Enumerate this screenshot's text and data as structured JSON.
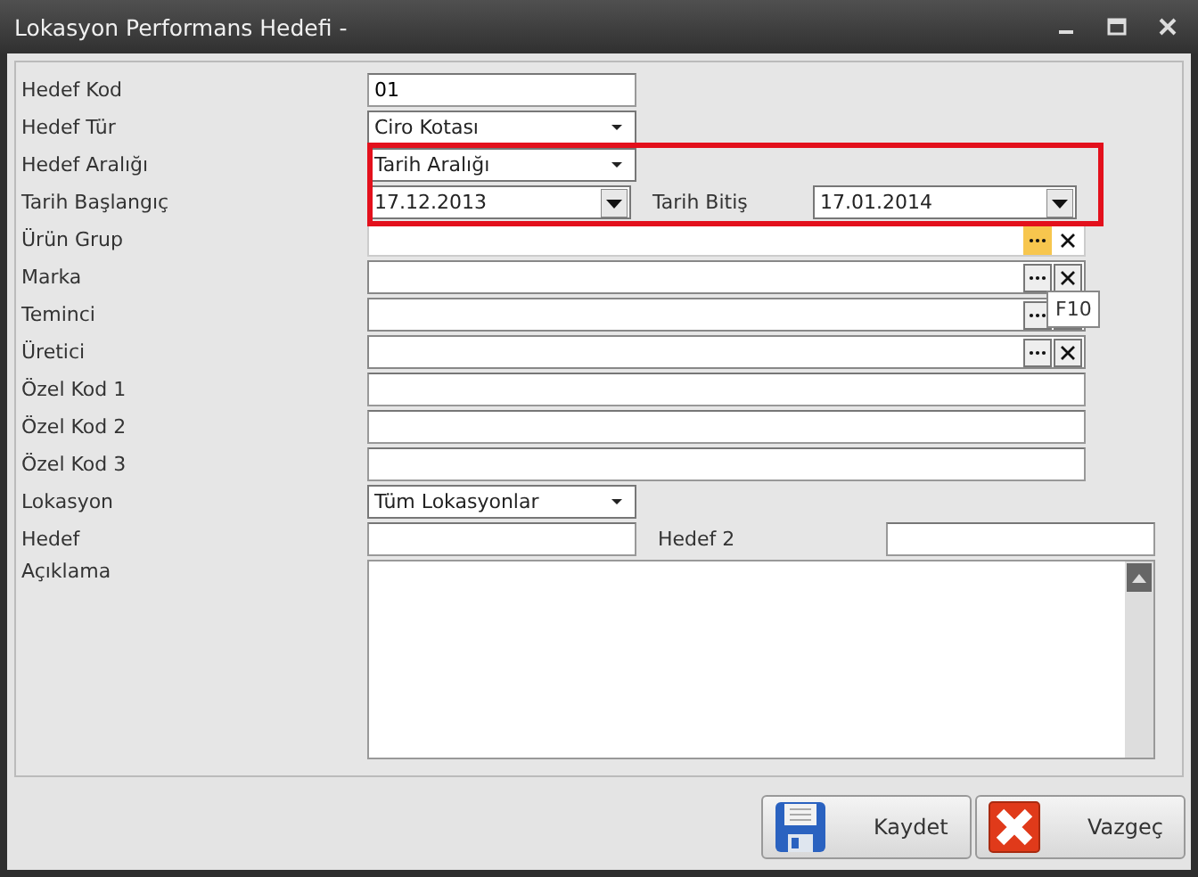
{
  "window": {
    "title": "Lokasyon Performans Hedefi -"
  },
  "fields": [
    {
      "kind": "short_field",
      "label": "Hedef Kod",
      "value": "01"
    },
    {
      "kind": "combo",
      "label": "Hedef Tür",
      "value": "Ciro Kotası"
    },
    {
      "kind": "combo",
      "label": "Hedef Aralığı",
      "value": "Tarih Aralığı"
    },
    {
      "kind": "date_range",
      "label": "Tarih Başlangıç",
      "value": "17.12.2013",
      "label_2": "Tarih Bitiş",
      "value_2": "17.01.2014"
    },
    {
      "kind": "lookup",
      "label": "Ürün Grup",
      "hover": true
    },
    {
      "kind": "lookup",
      "label": "Marka",
      "hover": false
    },
    {
      "kind": "lookup",
      "label": "Teminci",
      "hover": false
    },
    {
      "kind": "lookup",
      "label": "Üretici",
      "hover": false
    },
    {
      "kind": "field",
      "label": "Özel Kod 1"
    },
    {
      "kind": "field",
      "label": "Özel Kod 2"
    },
    {
      "kind": "field",
      "label": "Özel Kod 3"
    },
    {
      "kind": "combo",
      "label": "Lokasyon",
      "value": "Tüm Lokasyonlar"
    },
    {
      "kind": "pair",
      "label": "Hedef",
      "label_2": "Hedef 2"
    },
    {
      "kind": "memo",
      "label": "Açıklama"
    }
  ],
  "tooltip": {
    "text": "F10"
  },
  "buttons": [
    {
      "kind": "save",
      "label": "Kaydet"
    },
    {
      "kind": "cancel",
      "label": "Vazgeç"
    }
  ]
}
